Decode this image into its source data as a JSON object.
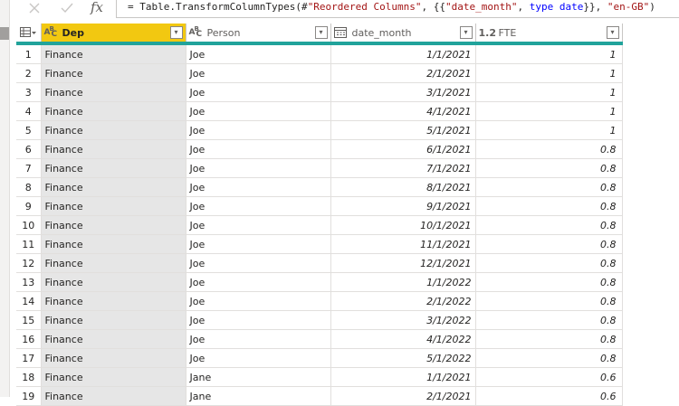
{
  "formula_bar": {
    "cancel_icon": "close-icon",
    "commit_icon": "check-icon",
    "fx_label": "fx",
    "formula_prefix": "= Table.TransformColumnTypes(#",
    "formula_step": "\"Reordered Columns\"",
    "formula_mid1": ", {{",
    "formula_col": "\"date_month\"",
    "formula_mid2": ", ",
    "formula_kw": "type date",
    "formula_mid3": "}}, ",
    "formula_culture": "\"en-GB\"",
    "formula_end": ")"
  },
  "columns": [
    {
      "type_label": "ABC",
      "name": "Dep",
      "selected": true
    },
    {
      "type_label": "ABC",
      "name": "Person"
    },
    {
      "type_label": "calendar",
      "name": "date_month"
    },
    {
      "type_label": "1.2",
      "name": "FTE"
    }
  ],
  "filter_glyph": "▾",
  "colors": {
    "selected_header": "#f2c811",
    "quality_bar": "#21a39b"
  },
  "rows": [
    {
      "n": "1",
      "dep": "Finance",
      "person": "Joe",
      "date": "1/1/2021",
      "fte": "1"
    },
    {
      "n": "2",
      "dep": "Finance",
      "person": "Joe",
      "date": "2/1/2021",
      "fte": "1"
    },
    {
      "n": "3",
      "dep": "Finance",
      "person": "Joe",
      "date": "3/1/2021",
      "fte": "1"
    },
    {
      "n": "4",
      "dep": "Finance",
      "person": "Joe",
      "date": "4/1/2021",
      "fte": "1"
    },
    {
      "n": "5",
      "dep": "Finance",
      "person": "Joe",
      "date": "5/1/2021",
      "fte": "1"
    },
    {
      "n": "6",
      "dep": "Finance",
      "person": "Joe",
      "date": "6/1/2021",
      "fte": "0.8"
    },
    {
      "n": "7",
      "dep": "Finance",
      "person": "Joe",
      "date": "7/1/2021",
      "fte": "0.8"
    },
    {
      "n": "8",
      "dep": "Finance",
      "person": "Joe",
      "date": "8/1/2021",
      "fte": "0.8"
    },
    {
      "n": "9",
      "dep": "Finance",
      "person": "Joe",
      "date": "9/1/2021",
      "fte": "0.8"
    },
    {
      "n": "10",
      "dep": "Finance",
      "person": "Joe",
      "date": "10/1/2021",
      "fte": "0.8"
    },
    {
      "n": "11",
      "dep": "Finance",
      "person": "Joe",
      "date": "11/1/2021",
      "fte": "0.8"
    },
    {
      "n": "12",
      "dep": "Finance",
      "person": "Joe",
      "date": "12/1/2021",
      "fte": "0.8"
    },
    {
      "n": "13",
      "dep": "Finance",
      "person": "Joe",
      "date": "1/1/2022",
      "fte": "0.8"
    },
    {
      "n": "14",
      "dep": "Finance",
      "person": "Joe",
      "date": "2/1/2022",
      "fte": "0.8"
    },
    {
      "n": "15",
      "dep": "Finance",
      "person": "Joe",
      "date": "3/1/2022",
      "fte": "0.8"
    },
    {
      "n": "16",
      "dep": "Finance",
      "person": "Joe",
      "date": "4/1/2022",
      "fte": "0.8"
    },
    {
      "n": "17",
      "dep": "Finance",
      "person": "Joe",
      "date": "5/1/2022",
      "fte": "0.8"
    },
    {
      "n": "18",
      "dep": "Finance",
      "person": "Jane",
      "date": "1/1/2021",
      "fte": "0.6"
    },
    {
      "n": "19",
      "dep": "Finance",
      "person": "Jane",
      "date": "2/1/2021",
      "fte": "0.6"
    }
  ]
}
